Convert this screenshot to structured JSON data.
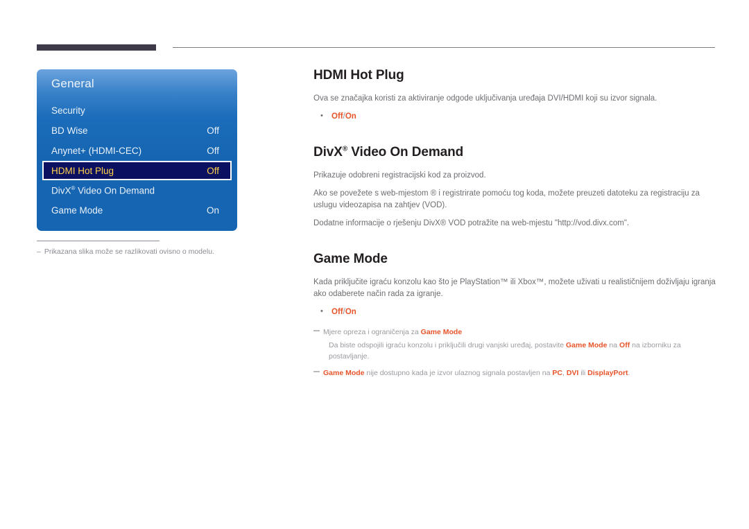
{
  "page": {
    "language_note": "hr"
  },
  "header": {
    "dark_bar": "",
    "rule": ""
  },
  "osd": {
    "title": "General",
    "items": [
      {
        "label": "Security",
        "value": "",
        "selected": false
      },
      {
        "label": "BD Wise",
        "value": "Off",
        "selected": false
      },
      {
        "label": "Anynet+ (HDMI-CEC)",
        "value": "Off",
        "selected": false
      },
      {
        "label": "HDMI Hot Plug",
        "value": "Off",
        "selected": true
      },
      {
        "label": "DivX",
        "label_sup": "®",
        "label_tail": " Video On Demand",
        "value": "",
        "selected": false
      },
      {
        "label": "Game Mode",
        "value": "On",
        "selected": false
      }
    ],
    "footnote_dash": "–",
    "footnote": "Prikazana slika može se razlikovati ovisno o modelu.",
    "colors": {
      "panel_top": "#6ba3dd",
      "panel_bottom": "#1565b2",
      "selected_bg": "#0b1060",
      "selected_text": "#ffd24a"
    }
  },
  "content": {
    "sections": [
      {
        "heading": "HDMI Hot Plug",
        "paragraphs": [
          "Ova se značajka koristi za aktiviranje odgode uključivanja uređaja DVI/HDMI koji su izvor signala."
        ],
        "bullet_off": "Off",
        "bullet_slash": "/",
        "bullet_on": "On"
      },
      {
        "heading_main": "DivX",
        "heading_sup": "®",
        "heading_tail": " Video On Demand",
        "paragraphs": [
          "Prikazuje odobreni registracijski kod za proizvod.",
          "Ako se povežete s web-mjestom ® i registrirate pomoću tog koda, možete preuzeti datoteku za registraciju za uslugu videozapisa na zahtjev (VOD).",
          "Dodatne informacije o rješenju  DivX® VOD potražite na web-mjestu \"http://vod.divx.com\"."
        ]
      },
      {
        "heading": "Game Mode",
        "paragraphs": [
          "Kada priključite igraću konzolu kao što je PlayStation™ ili Xbox™, možete uživati u realističnijem doživljaju igranja ako odaberete način rada za igranje."
        ],
        "bullet_off": "Off",
        "bullet_slash": "/",
        "bullet_on": "On"
      }
    ],
    "notes": {
      "note1_pre": "Mjere opreza i ograničenja za ",
      "note1_bold": "Game Mode",
      "note2_pre": "Da biste odspojili igraću konzolu i priključili drugi vanjski uređaj, postavite ",
      "note2_b1": "Game Mode",
      "note2_mid": " na ",
      "note2_b2": "Off",
      "note2_tail": " na izborniku za postavljanje.",
      "note3_b1": "Game Mode",
      "note3_mid": " nije dostupno kada je izvor ulaznog signala postavljen na ",
      "note3_b2": "PC",
      "note3_sep1": ", ",
      "note3_b3": "DVI",
      "note3_sep2": " ili ",
      "note3_b4": "DisplayPort",
      "note3_tail": "."
    },
    "accent_color": "#e8542a"
  }
}
